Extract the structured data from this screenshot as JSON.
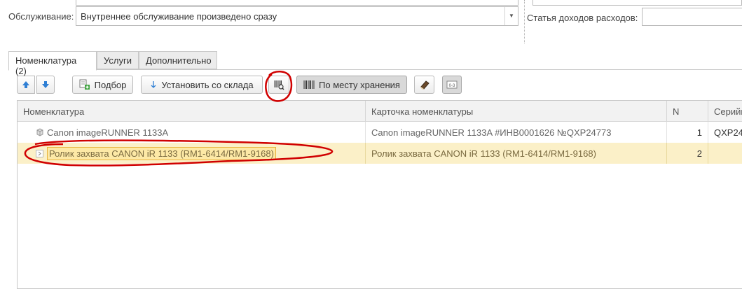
{
  "form": {
    "service_label": "Обслуживание:",
    "service_value": "Внутреннее обслуживание произведено сразу",
    "income_label": "Статья доходов расходов:",
    "income_value": ""
  },
  "tabs": [
    {
      "label": "Номенклатура (2)",
      "active": true
    },
    {
      "label": "Услуги",
      "active": false
    },
    {
      "label": "Дополнительно",
      "active": false
    }
  ],
  "toolbar": {
    "pick_label": "Подбор",
    "set_from_stock_label": "Установить со склада",
    "by_storage_label": "По месту хранения"
  },
  "table": {
    "columns": [
      "Номенклатура",
      "Карточка номенклатуры",
      "N",
      "Серийн"
    ],
    "rows": [
      {
        "nomenclature": "Canon imageRUNNER 1133A",
        "card": "Canon imageRUNNER 1133A #ИНВ0001626 №QXP24773",
        "n": "1",
        "serial": "QXP24",
        "selected": false
      },
      {
        "nomenclature": "Ролик захвата CANON iR 1133 (RM1-6414/RM1-9168)",
        "card": "Ролик захвата CANON iR 1133 (RM1-6414/RM1-9168)",
        "n": "2",
        "serial": "",
        "selected": true
      }
    ]
  },
  "colors": {
    "selected_row": "#fbf0c8",
    "annotation": "#d00000",
    "arrow_blue": "#2f7fd4"
  },
  "icons": [
    "move-up-icon",
    "move-down-icon",
    "pick-icon",
    "arrow-down-icon",
    "barcode-search-icon",
    "barcode-icon",
    "eraser-icon",
    "barcode-number-icon",
    "product-icon",
    "item-expand-icon"
  ]
}
